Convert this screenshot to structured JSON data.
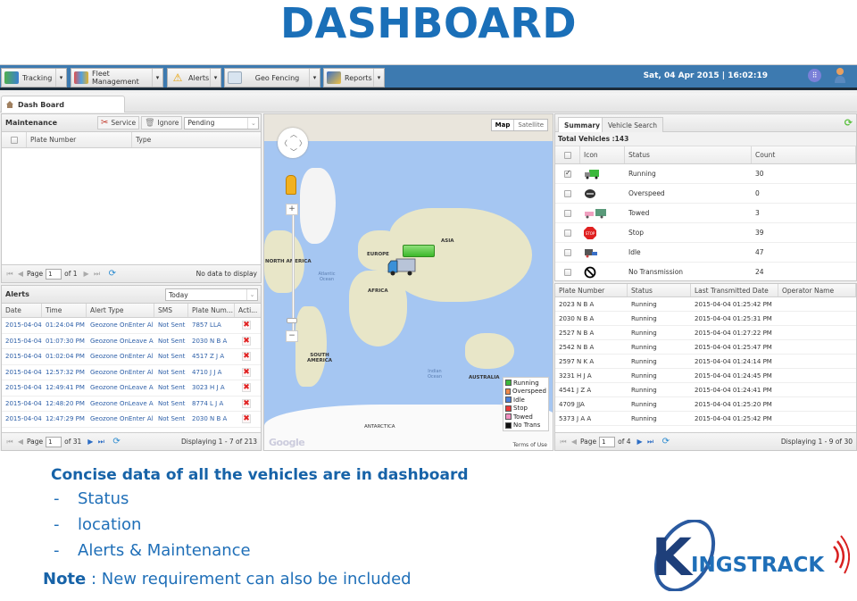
{
  "slide": {
    "title": "DASHBOARD",
    "heading": "Concise data of all the vehicles are in dashboard",
    "bullets": [
      "Status",
      "location",
      "Alerts & Maintenance"
    ],
    "bullet_marker": "-",
    "note_label": "Note",
    "note_text": " : New requirement can also be included",
    "logo_text": "INGSTRACK",
    "logo_letter": "K"
  },
  "topbar": {
    "menus": [
      {
        "label": "Tracking",
        "icon": "truck-icon"
      },
      {
        "label": "Fleet Management",
        "icon": "people-icon"
      },
      {
        "label": "Alerts",
        "icon": "warning-icon"
      },
      {
        "label": "Geo Fencing",
        "icon": "map-icon"
      },
      {
        "label": "Reports",
        "icon": "report-icon"
      }
    ],
    "caret": "▾",
    "datetime": "Sat, 04 Apr 2015 | 16:02:19",
    "apps_glyph": "⠿"
  },
  "main_tab": {
    "label": "Dash Board"
  },
  "maintenance": {
    "title": "Maintenance",
    "service_label": "Service",
    "ignore_label": "Ignore",
    "filter_value": "Pending",
    "columns": [
      "Plate Number",
      "Type"
    ],
    "pager": {
      "page_label": "Page",
      "page": "1",
      "of": "of 1",
      "info": "No data to display"
    }
  },
  "alerts": {
    "title": "Alerts",
    "filter_value": "Today",
    "columns": [
      "Date",
      "Time",
      "Alert Type",
      "SMS",
      "Plate Num...",
      "Acti..."
    ],
    "rows": [
      {
        "date": "2015-04-04",
        "time": "01:24:04 PM",
        "type": "Geozone OnEnter Al",
        "sms": "Not Sent",
        "plate": "7857 LLA"
      },
      {
        "date": "2015-04-04",
        "time": "01:07:30 PM",
        "type": "Geozone OnLeave A",
        "sms": "Not Sent",
        "plate": "2030 N B A"
      },
      {
        "date": "2015-04-04",
        "time": "01:02:04 PM",
        "type": "Geozone OnEnter Al",
        "sms": "Not Sent",
        "plate": "4517 Z J A"
      },
      {
        "date": "2015-04-04",
        "time": "12:57:32 PM",
        "type": "Geozone OnEnter Al",
        "sms": "Not Sent",
        "plate": "4710 J J A"
      },
      {
        "date": "2015-04-04",
        "time": "12:49:41 PM",
        "type": "Geozone OnLeave A",
        "sms": "Not Sent",
        "plate": "3023 H J A"
      },
      {
        "date": "2015-04-04",
        "time": "12:48:20 PM",
        "type": "Geozone OnLeave A",
        "sms": "Not Sent",
        "plate": "8774 L J A"
      },
      {
        "date": "2015-04-04",
        "time": "12:47:29 PM",
        "type": "Geozone OnEnter Al",
        "sms": "Not Sent",
        "plate": "2030 N B A"
      }
    ],
    "delete_glyph": "✖",
    "pager": {
      "page_label": "Page",
      "page": "1",
      "of": "of 31",
      "info": "Displaying 1 - 7 of 213"
    }
  },
  "map": {
    "type_map": "Map",
    "type_satellite": "Satellite",
    "labels": {
      "north_america": "NORTH AMERICA",
      "south_america": "SOUTH AMERICA",
      "europe": "EUROPE",
      "africa": "AFRICA",
      "asia": "ASIA",
      "australia": "AUSTRALIA",
      "antarctica": "ANTARCTICA",
      "atlantic": "Atlantic Ocean",
      "indian": "Indian Ocean"
    },
    "legend": [
      {
        "label": "Running",
        "color": "#3cb83c"
      },
      {
        "label": "Overspeed",
        "color": "#f08a4a"
      },
      {
        "label": "Idle",
        "color": "#4a7fd8"
      },
      {
        "label": "Stop",
        "color": "#e83a3a"
      },
      {
        "label": "Towed",
        "color": "#f090c0"
      },
      {
        "label": "No Trans",
        "color": "#111111"
      }
    ],
    "terms": "Terms of Use",
    "google": "Google",
    "zoom_in": "+",
    "zoom_out": "−"
  },
  "summary": {
    "tabs": [
      "Summary",
      "Vehicle Search"
    ],
    "total_label": "Total Vehicles :143",
    "columns": [
      "Icon",
      "Status",
      "Count"
    ],
    "rows": [
      {
        "status": "Running",
        "count": "30",
        "checked": true,
        "icon": "running-truck-icon"
      },
      {
        "status": "Overspeed",
        "count": "0",
        "checked": false,
        "icon": "speedometer-icon"
      },
      {
        "status": "Towed",
        "count": "3",
        "checked": false,
        "icon": "tow-truck-icon"
      },
      {
        "status": "Stop",
        "count": "39",
        "checked": false,
        "icon": "stop-sign-icon"
      },
      {
        "status": "Idle",
        "count": "47",
        "checked": false,
        "icon": "idle-truck-icon"
      },
      {
        "status": "No Transmission",
        "count": "24",
        "checked": false,
        "icon": "no-transmission-icon"
      }
    ]
  },
  "vehicles": {
    "columns": [
      "Plate Number",
      "Status",
      "Last Transmitted Date",
      "Operator Name"
    ],
    "rows": [
      {
        "plate": "2023 N B A",
        "status": "Running",
        "date": "2015-04-04 01:25:42 PM",
        "operator": ""
      },
      {
        "plate": "2030 N B A",
        "status": "Running",
        "date": "2015-04-04 01:25:31 PM",
        "operator": ""
      },
      {
        "plate": "2527 N B A",
        "status": "Running",
        "date": "2015-04-04 01:27:22 PM",
        "operator": ""
      },
      {
        "plate": "2542 N B A",
        "status": "Running",
        "date": "2015-04-04 01:25:47 PM",
        "operator": ""
      },
      {
        "plate": "2597 N K A",
        "status": "Running",
        "date": "2015-04-04 01:24:14 PM",
        "operator": ""
      },
      {
        "plate": "3231 H J A",
        "status": "Running",
        "date": "2015-04-04 01:24:45 PM",
        "operator": ""
      },
      {
        "plate": "4541 J Z A",
        "status": "Running",
        "date": "2015-04-04 01:24:41 PM",
        "operator": ""
      },
      {
        "plate": "4709 JJA",
        "status": "Running",
        "date": "2015-04-04 01:25:20 PM",
        "operator": ""
      },
      {
        "plate": "5373 J A A",
        "status": "Running",
        "date": "2015-04-04 01:25:42 PM",
        "operator": ""
      }
    ],
    "pager": {
      "page_label": "Page",
      "page": "1",
      "of": "of 4",
      "info": "Displaying 1 - 9 of 30"
    }
  },
  "pager_glyphs": {
    "first": "⏮",
    "prev": "◀",
    "next": "▶",
    "last": "⏭",
    "refresh": "⟳"
  }
}
